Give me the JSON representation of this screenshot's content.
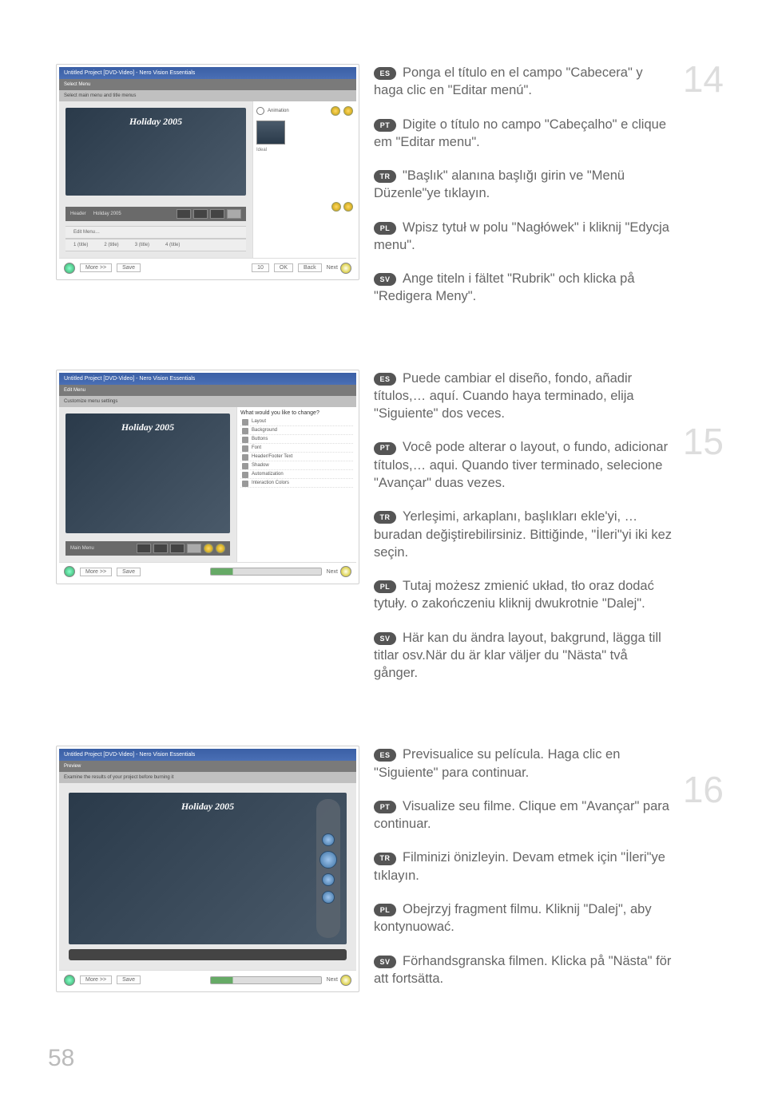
{
  "page_number": "58",
  "screenshots": {
    "app_title": "Untitled Project [DVD-Video] - Nero Vision Essentials",
    "holiday_caption": "Holiday 2005",
    "select_menu_heading": "Select Menu",
    "select_menu_sub": "Select main menu and title menus",
    "edit_menu_heading": "Edit Menu",
    "edit_menu_sub": "Customize menu settings",
    "preview_heading": "Preview",
    "preview_sub": "Examine the results of your project before burning it",
    "side_head": "What would you like to change?",
    "side_items": [
      "Layout",
      "Background",
      "Buttons",
      "Font",
      "Header/Footer Text",
      "Shadow",
      "Automatization",
      "Interaction Colors"
    ],
    "toolbar_more": "More >>",
    "toolbar_save": "Save",
    "nav_next": "Next",
    "nav_back": "Back",
    "editmenu_items": [
      "1 (title)",
      "2 (title)",
      "3 (title)",
      "4 (title)"
    ]
  },
  "steps": [
    {
      "number": "14",
      "langs": [
        {
          "code": "ES",
          "text": "Ponga el título en el campo \"Cabecera\" y haga clic en \"Editar menú\"."
        },
        {
          "code": "PT",
          "text": "Digite o título no campo \"Cabeçalho\" e clique em \"Editar menu\"."
        },
        {
          "code": "TR",
          "text": "\"Başlık\" alanına başlığı girin ve \"Menü Düzenle\"ye tıklayın."
        },
        {
          "code": "PL",
          "text": "Wpisz tytuł w polu \"Nagłówek\" i kliknij \"Edycja menu\"."
        },
        {
          "code": "SV",
          "text": "Ange titeln i fältet \"Rubrik\" och klicka på \"Redigera Meny\"."
        }
      ]
    },
    {
      "number": "15",
      "langs": [
        {
          "code": "ES",
          "text": "Puede cambiar el diseño, fondo, añadir títulos,… aquí. Cuando haya terminado, elija \"Siguiente\" dos veces."
        },
        {
          "code": "PT",
          "text": "Você pode alterar o layout, o fundo, adicionar títulos,… aqui. Quando tiver terminado, selecione \"Avançar\" duas vezes."
        },
        {
          "code": "TR",
          "text": "Yerleşimi, arkaplanı, başlıkları ekle'yi, … buradan değiştirebilirsiniz. Bittiğinde, \"İleri\"yi iki kez seçin."
        },
        {
          "code": "PL",
          "text": "Tutaj możesz zmienić układ, tło oraz dodać tytuły. o zakończeniu kliknij dwukrotnie \"Dalej\"."
        },
        {
          "code": "SV",
          "text": "Här kan du ändra layout, bakgrund, lägga till titlar osv.När du är klar väljer du \"Nästa\" två gånger."
        }
      ]
    },
    {
      "number": "16",
      "langs": [
        {
          "code": "ES",
          "text": "Previsualice su película. Haga clic en \"Siguiente\" para continuar."
        },
        {
          "code": "PT",
          "text": "Visualize seu filme. Clique em \"Avançar\" para continuar."
        },
        {
          "code": "TR",
          "text": "Filminizi önizleyin. Devam etmek için \"İleri\"ye tıklayın."
        },
        {
          "code": "PL",
          "text": "Obejrzyj fragment filmu. Kliknij \"Dalej\", aby kontynuować."
        },
        {
          "code": "SV",
          "text": "Förhandsgranska filmen. Klicka på \"Nästa\" för att fortsätta."
        }
      ]
    }
  ]
}
